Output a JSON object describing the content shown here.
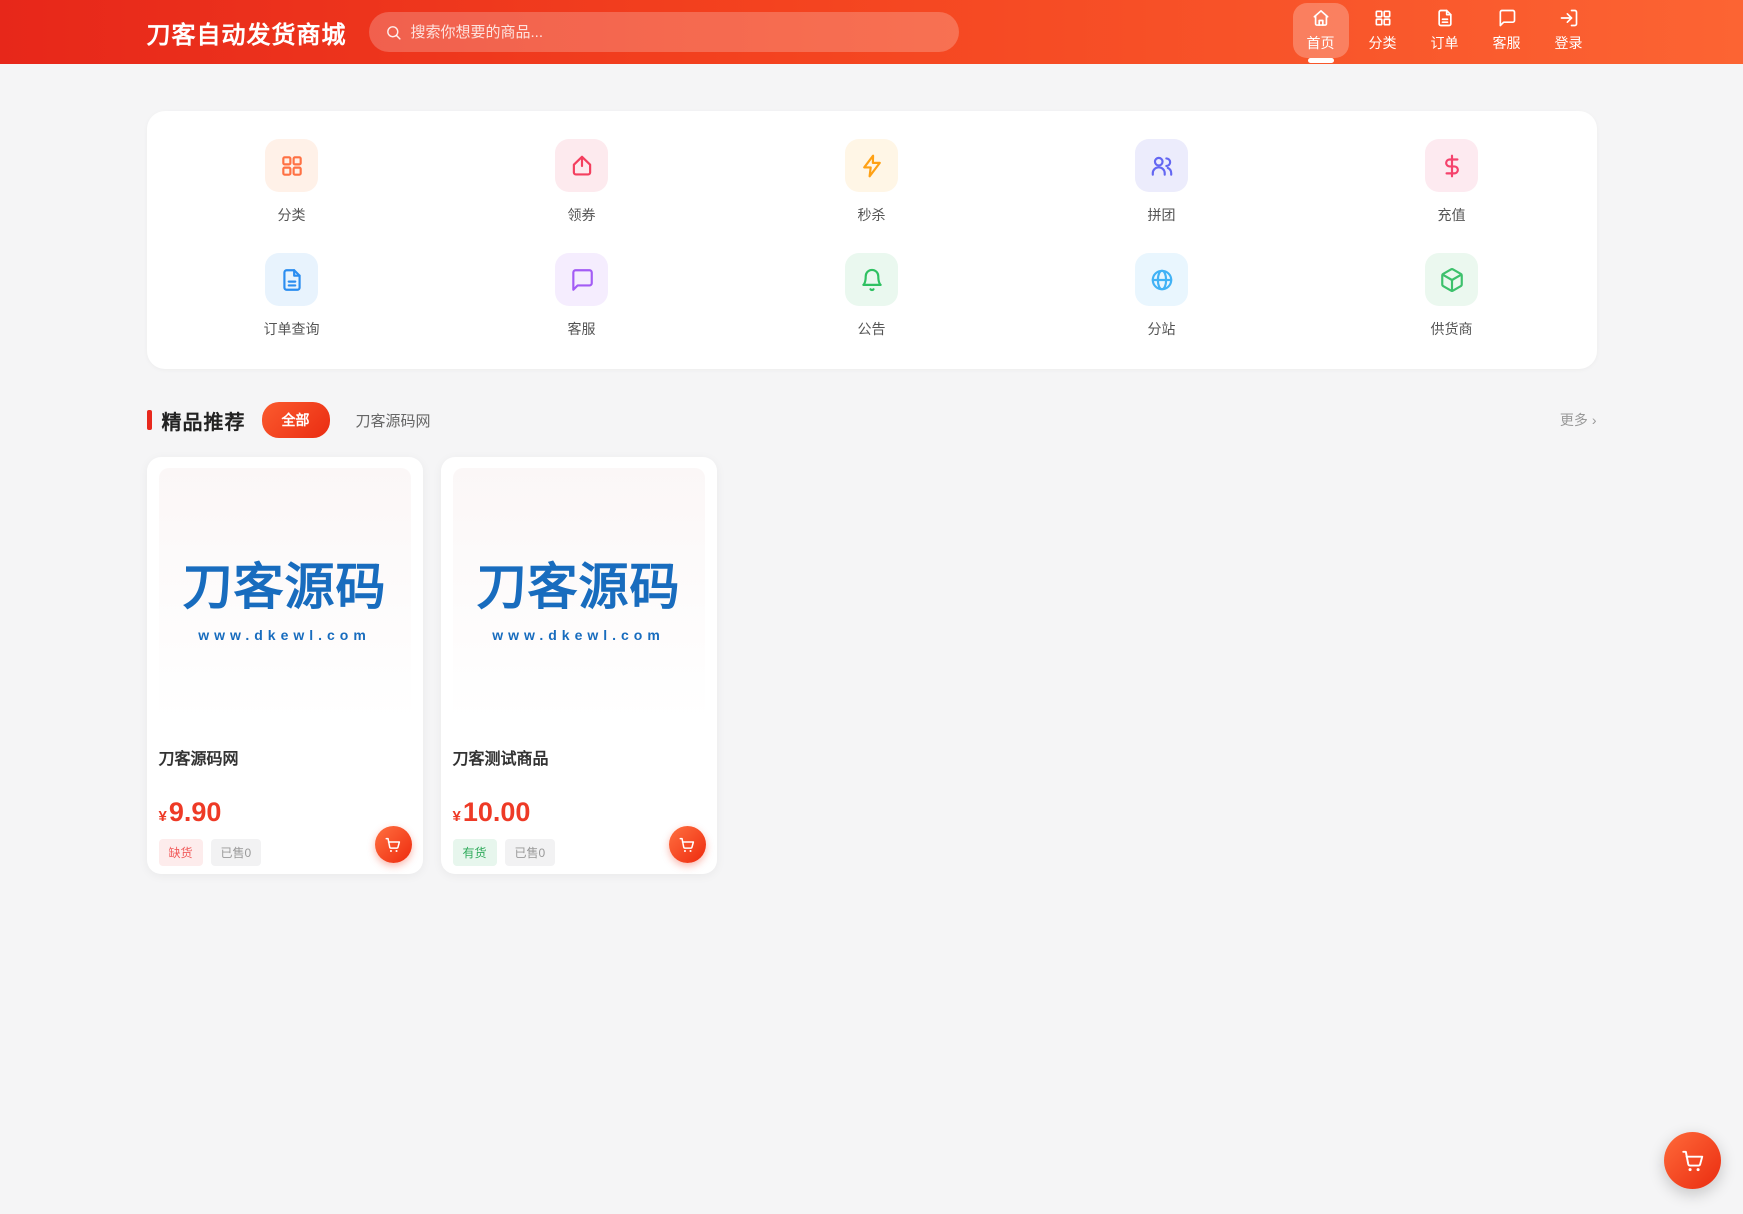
{
  "navbar": {
    "brand": "刀客自动发货商城",
    "search": {
      "placeholder": "搜索你想要的商品...",
      "icon": "search-icon"
    },
    "items": [
      {
        "label": "首页",
        "icon": "home-icon",
        "active": true
      },
      {
        "label": "分类",
        "icon": "grid-icon",
        "active": false
      },
      {
        "label": "订单",
        "icon": "document-icon",
        "active": false
      },
      {
        "label": "客服",
        "icon": "chat-icon",
        "active": false
      },
      {
        "label": "登录",
        "icon": "login-icon",
        "active": false
      }
    ],
    "gradient": [
      "#e7271a",
      "#fc6433"
    ]
  },
  "quick_links": {
    "items": [
      {
        "label": "分类",
        "icon": "grid-icon",
        "style": "color:#ff7143;background:#fff1e8"
      },
      {
        "label": "领券",
        "icon": "coupon-icon",
        "style": "color:#f43f5e;background:#fdeaee"
      },
      {
        "label": "秒杀",
        "icon": "lightning-icon",
        "style": "color:#ffa114;background:#fff6e6"
      },
      {
        "label": "拼团",
        "icon": "users-icon",
        "style": "color:#6467f2;background:#ececfc"
      },
      {
        "label": "充值",
        "icon": "dollar-icon",
        "style": "color:#f5426c;background:#fdeaf0"
      },
      {
        "label": "订单查询",
        "icon": "document-icon",
        "style": "color:#2b8df0;background:#e8f3fd"
      },
      {
        "label": "客服",
        "icon": "chat-icon",
        "style": "color:#a35cf5;background:#f5edfe"
      },
      {
        "label": "公告",
        "icon": "bell-icon",
        "style": "color:#2fc162;background:#eaf8ef"
      },
      {
        "label": "分站",
        "icon": "globe-icon",
        "style": "color:#41b2f5;background:#e9f6fe"
      },
      {
        "label": "供货商",
        "icon": "cube-icon",
        "style": "color:#3dc16c;background:#ebf8ef"
      }
    ]
  },
  "section": {
    "title": "精品推荐",
    "accent_color": "#e8291d",
    "tabs": [
      {
        "label": "全部",
        "active": true
      },
      {
        "label": "刀客源码网",
        "active": false
      }
    ],
    "more": "更多",
    "more_chevron": "›"
  },
  "products": [
    {
      "title": "刀客源码网",
      "currency": "¥",
      "price": "9.90",
      "price_color": "#ee3a26",
      "stock_label": "缺货",
      "stock_style": "color:#f15b5b;background:#fdecec",
      "sold": "已售0",
      "image": {
        "line1": "刀客源码",
        "line2": "www.dkewl.com",
        "color": "#186cbe"
      }
    },
    {
      "title": "刀客测试商品",
      "currency": "¥",
      "price": "10.00",
      "price_color": "#ee3a26",
      "stock_label": "有货",
      "stock_style": "color:#2fab5b;background:#e7f6ed",
      "sold": "已售0",
      "image": {
        "line1": "刀客源码",
        "line2": "www.dkewl.com",
        "color": "#186cbe"
      }
    }
  ],
  "floating_cart": {
    "icon": "cart-icon"
  }
}
